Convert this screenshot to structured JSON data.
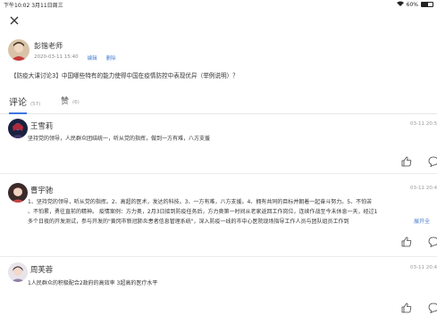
{
  "status_bar": {
    "time_date": "下午10:02  3月11日周三",
    "battery": "60%",
    "battery_level": 0.6
  },
  "post": {
    "author": "彭锴老师",
    "datetime": "2020-03-11 15:40",
    "edit_label": "编辑",
    "delete_label": "删除",
    "title": "【防疫大课讨论3】中国哪些特有的能力使得中国在疫情防控中表现优异（举例说明）？"
  },
  "tabs": [
    {
      "label": "评论",
      "count": "(57)"
    },
    {
      "label": "赞",
      "count": "(6)"
    }
  ],
  "comments": [
    {
      "name": "王雪莉",
      "time": "03-11 20:5",
      "lines": [
        "坚持党的领导，人民群众团结统一，听从党的指挥，做到一方有难，八方支援"
      ]
    },
    {
      "name": "曹宇驰",
      "time": "03-11 20:4",
      "lines": [
        "1、坚持党的领导，听从党的指挥。2、高超的医术，发达的科技。3、一方有难，八方支援。4、拥有共同的目标并朝着一起奋斗努力。5、不怕苦",
        "、不怕累，勇往直前的精神。 疫情案例：方力奥，2月3日接到防疫任务后，方力奥第一时间从老家返回工作岗位，连续作战至今未休息一天，经过1",
        "多个日夜的开发测试，参与开发的\"黄冈市新冠肺炎患者信息管理系统\"，深入防疫一线的市中心医院现场指导工作人员与团队组员工作到"
      ],
      "expand": "展开全"
    },
    {
      "name": "周芙蓉",
      "time": "03-11 20:4",
      "lines": [
        "1人民群众的积极配合2政府的高效率 3超高的医疗水平"
      ]
    }
  ]
}
